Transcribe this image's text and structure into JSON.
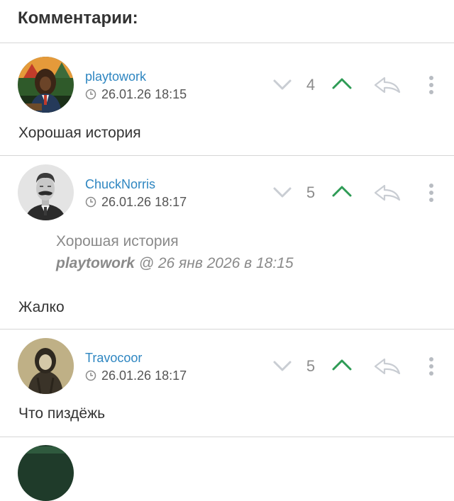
{
  "header": {
    "title": "Комментарии:"
  },
  "comments": [
    {
      "username": "playtowork",
      "time": "26.01.26 18:15",
      "votes": "4",
      "text": "Хорошая история"
    },
    {
      "username": "ChuckNorris",
      "time": "26.01.26 18:17",
      "votes": "5",
      "quote": {
        "text": "Хорошая история",
        "author": "playtowork",
        "at": " @ 26 янв 2026 в 18:15"
      },
      "text": "Жалко"
    },
    {
      "username": "Travocoor",
      "time": "26.01.26 18:17",
      "votes": "5",
      "text": "Что пиздёжь"
    }
  ],
  "colors": {
    "username": "#2e86c1",
    "upvote": "#2e9b55",
    "muted_icon": "#c9cdd3"
  },
  "icons": [
    "clock-icon",
    "chevron-down-icon",
    "chevron-up-icon",
    "reply-icon",
    "more-vertical-icon"
  ]
}
